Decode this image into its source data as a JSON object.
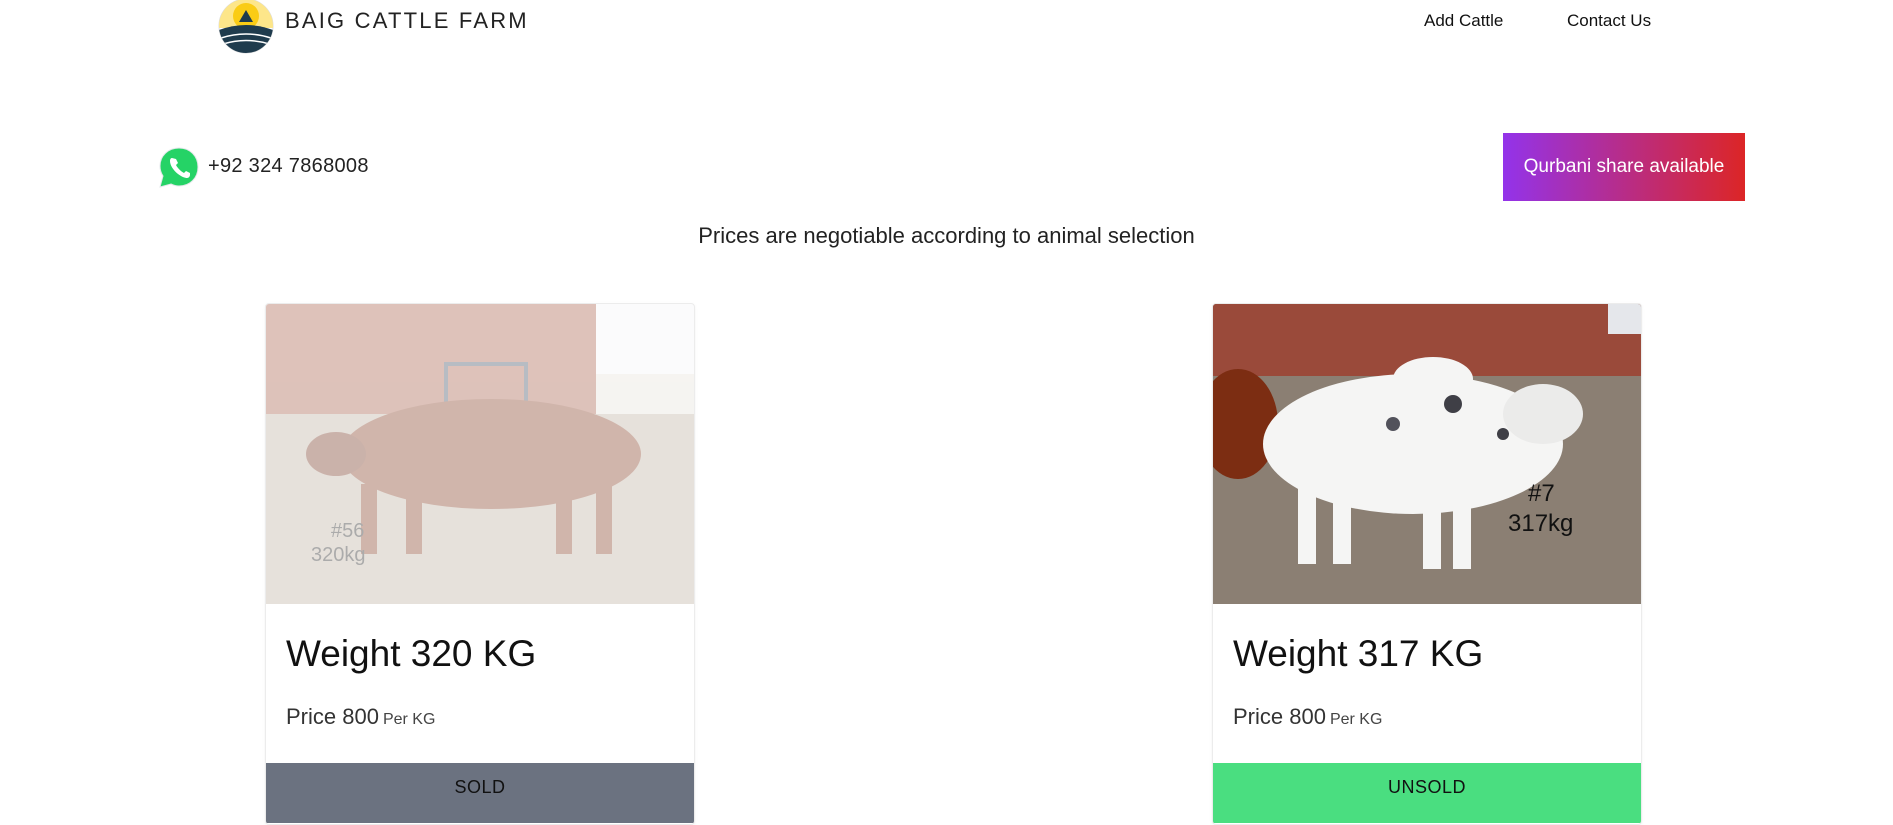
{
  "header": {
    "brand_name": "BAIG CATTLE FARM",
    "nav": {
      "add_cattle": "Add Cattle",
      "contact_us": "Contact Us"
    }
  },
  "contact": {
    "phone": "+92 324 7868008",
    "qurbani_button": "Qurbani share available",
    "notice": "Prices are negotiable according to animal selection"
  },
  "cattle": [
    {
      "weight_label": "Weight 320 KG",
      "price_label": "Price 800",
      "price_unit": "Per KG",
      "status": "SOLD",
      "photo_tag_number": "#56",
      "photo_tag_weight": "320kg"
    },
    {
      "weight_label": "Weight 317 KG",
      "price_label": "Price 800",
      "price_unit": "Per KG",
      "status": "UNSOLD",
      "photo_tag_number": "#7",
      "photo_tag_weight": "317kg"
    }
  ],
  "colors": {
    "sold": "#6b7280",
    "unsold": "#4ade80",
    "gradient_start": "#9333ea",
    "gradient_end": "#dc2626",
    "whatsapp": "#25d366"
  },
  "icons": {
    "logo": "farm-logo-icon",
    "whatsapp": "whatsapp-icon"
  }
}
